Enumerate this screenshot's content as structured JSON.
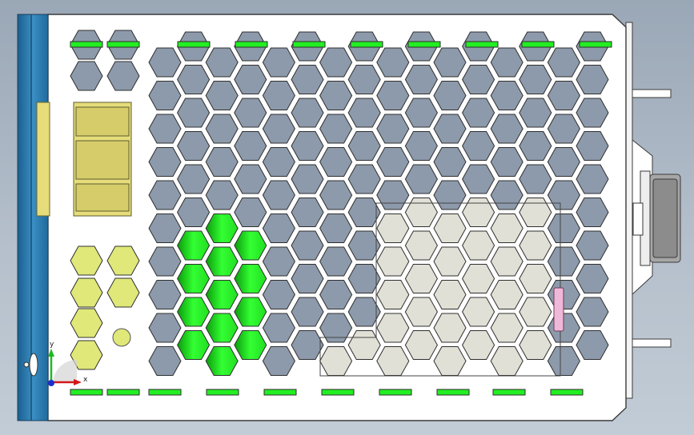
{
  "viewport": {
    "background_top": "#9aa7b6",
    "background_bottom": "#c2ccd6"
  },
  "model": {
    "panel_color": "#ffffff",
    "outline_color": "#3a3a3a",
    "hole_color": "#8d9aab",
    "green_color": "#22ee22",
    "yellow_color": "#dede76",
    "lightyellow_color": "#dfe878",
    "blue_rail_color": "#2e7fb5",
    "gray_component_color": "#e0e0d6",
    "pink_color": "#f0b8d8"
  },
  "triad": {
    "x_label": "x",
    "y_label": "y"
  }
}
